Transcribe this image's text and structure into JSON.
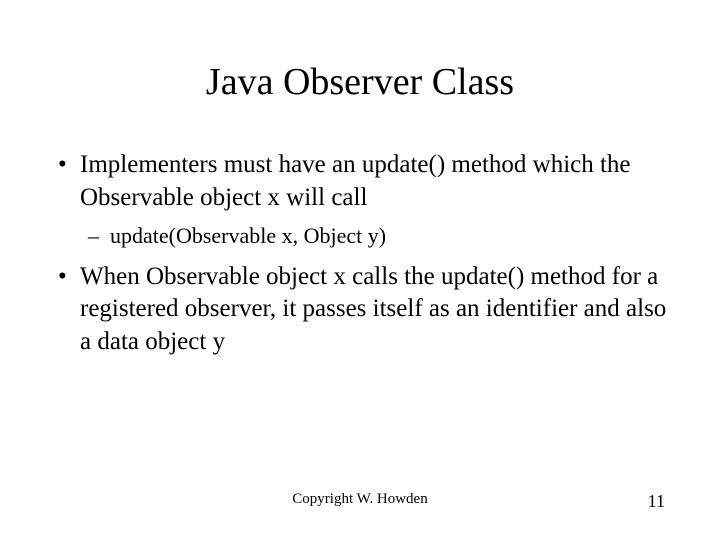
{
  "title": "Java Observer Class",
  "bullets": [
    {
      "text": "Implementers must have an update() method which the Observable object x will call",
      "sub": "update(Observable x, Object y)"
    },
    {
      "text": "When Observable object x calls the update() method for a registered observer, it passes itself as an identifier and also a data object y",
      "sub": null
    }
  ],
  "footer": {
    "copyright": "Copyright W. Howden",
    "page": "11"
  }
}
